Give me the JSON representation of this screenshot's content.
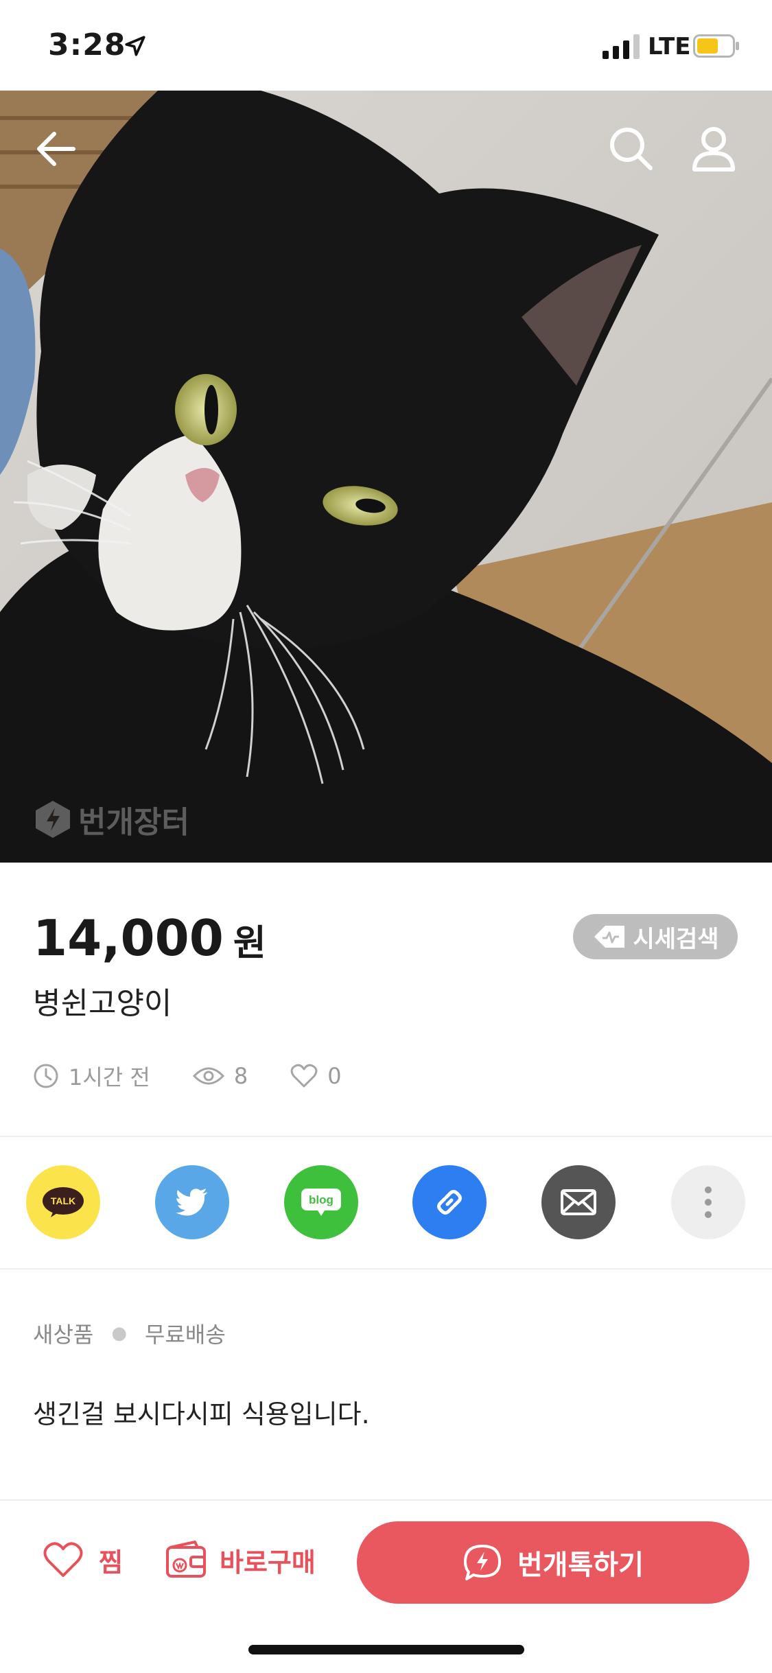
{
  "status_bar": {
    "time": "3:28",
    "network": "LTE"
  },
  "hero": {
    "watermark": "번개장터"
  },
  "product": {
    "price": "14,000",
    "price_unit": "원",
    "market_search_label": "시세검색",
    "title": "병쉰고양이",
    "posted": "1시간 전",
    "views": "8",
    "likes": "0",
    "condition": "새상품",
    "shipping": "무료배송",
    "description": "생긴걸 보시다시피 식용입니다."
  },
  "share": {
    "kakao_label": "TALK",
    "blog_label": "blog"
  },
  "bottom_bar": {
    "wish_label": "찜",
    "buy_label": "바로구매",
    "talk_label": "번개톡하기"
  },
  "colors": {
    "accent": "#e9575f",
    "kakao": "#fbe44b",
    "twitter": "#5aa7e7",
    "blog": "#3ec03c",
    "link": "#2d7ef0",
    "mail": "#555555"
  }
}
